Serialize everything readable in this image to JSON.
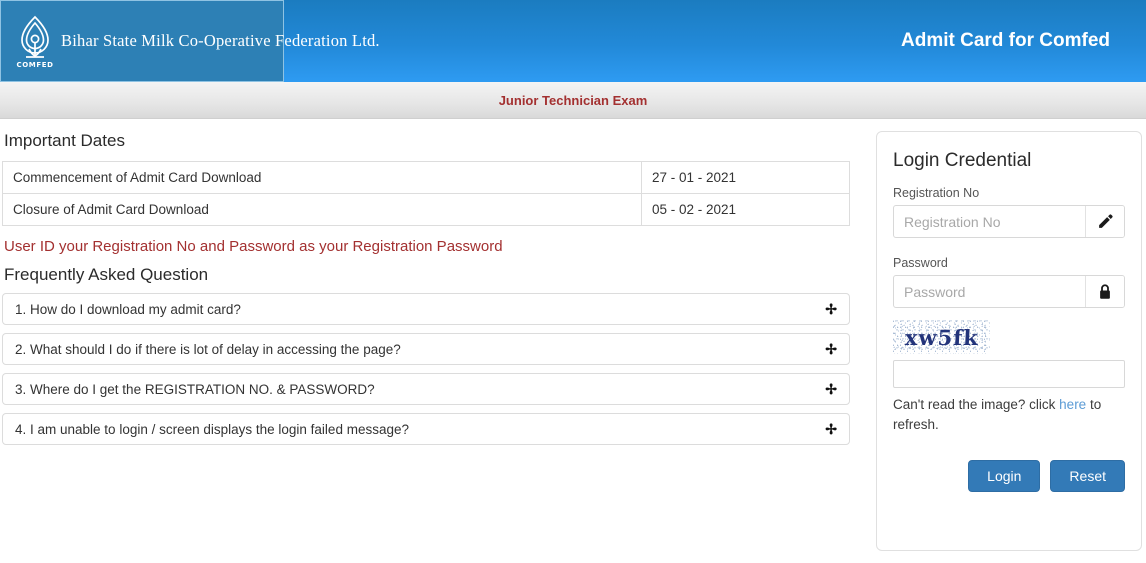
{
  "header": {
    "org_name": "Bihar State Milk Co-Operative Federation Ltd.",
    "logo_caption": "COMFED",
    "title": "Admit Card for Comfed",
    "brand_blue": "#2289d8",
    "logo_box_color": "#2d80b5"
  },
  "subbar": {
    "exam_name": "Junior Technician Exam",
    "color": "#a33030"
  },
  "important_dates": {
    "heading": "Important Dates",
    "rows": [
      {
        "label": "Commencement of Admit Card Download",
        "value": "27 - 01 - 2021"
      },
      {
        "label": "Closure of Admit Card Download",
        "value": "05 - 02 - 2021"
      }
    ]
  },
  "notice": "User ID your Registration No and Password as your Registration Password",
  "faq": {
    "heading": "Frequently Asked Question",
    "items": [
      {
        "question": "1. How do I download my admit card?",
        "chevron": "chevron-down-icon"
      },
      {
        "question": "2. What should I do if there is lot of delay in accessing the page?",
        "chevron": "chevron-down-icon"
      },
      {
        "question": "3. Where do I get the REGISTRATION NO. & PASSWORD?",
        "chevron": "chevron-down-icon"
      },
      {
        "question": "4. I am unable to login / screen displays the login failed message?",
        "chevron": "chevron-down-icon"
      }
    ]
  },
  "login": {
    "heading": "Login Credential",
    "registration": {
      "label": "Registration No",
      "placeholder": "Registration No",
      "value": "",
      "icon": "pencil-icon"
    },
    "password": {
      "label": "Password",
      "placeholder": "Password",
      "value": "",
      "icon": "lock-icon"
    },
    "captcha": {
      "text": "xw5fk",
      "value": "",
      "placeholder": "",
      "hint_before": "Can't read the image? click ",
      "hint_link": "here",
      "hint_after": " to refresh.",
      "link_color": "#5b9bd5"
    },
    "buttons": {
      "login_label": "Login",
      "reset_label": "Reset",
      "color": "#337ab7"
    }
  }
}
